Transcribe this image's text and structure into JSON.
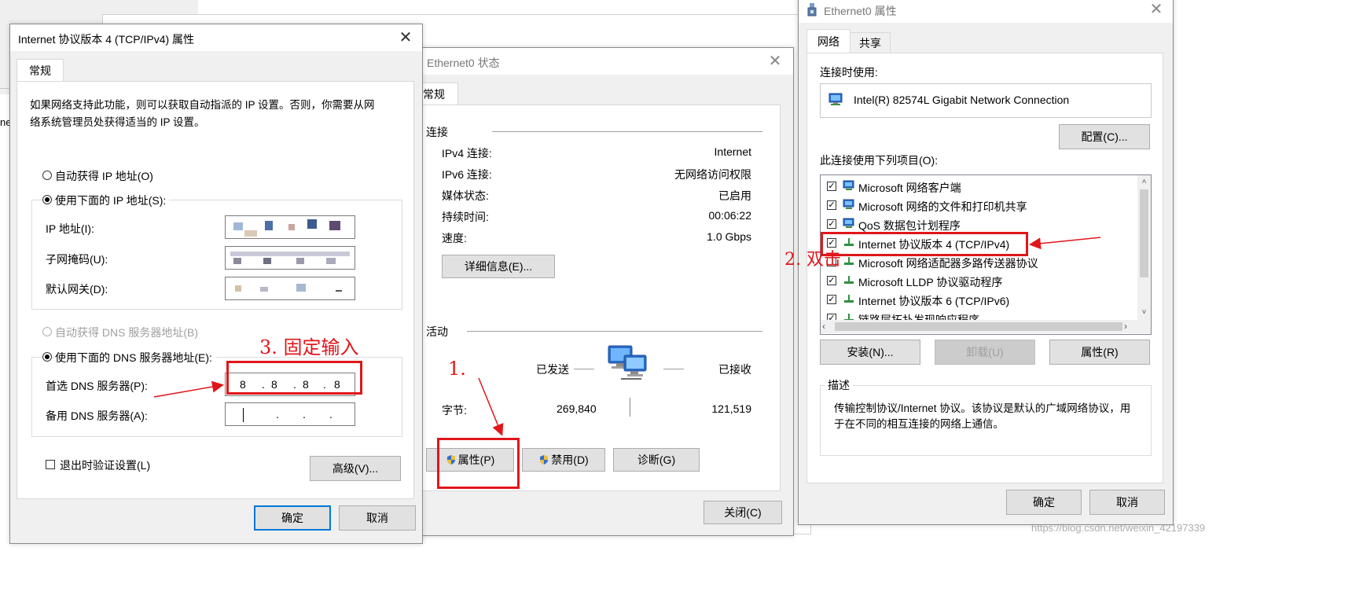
{
  "bg_window": {
    "left_fragment_text": "ne"
  },
  "ipv4_dialog": {
    "title": "Internet 协议版本 4 (TCP/IPv4) 属性",
    "tab_general": "常规",
    "description": "如果网络支持此功能，则可以获取自动指派的 IP 设置。否则，你需要从网络系统管理员处获得适当的 IP 设置。",
    "description_line1": "如果网络支持此功能，则可以获取自动指派的 IP 设置。否则，你需要从网",
    "description_line2": "络系统管理员处获得适当的 IP 设置。",
    "radio_auto_ip": "自动获得 IP 地址(O)",
    "radio_manual_ip": "使用下面的 IP 地址(S):",
    "ip_label": "IP 地址(I):",
    "mask_label": "子网掩码(U):",
    "gateway_label": "默认网关(D):",
    "radio_auto_dns": "自动获得 DNS 服务器地址(B)",
    "radio_manual_dns": "使用下面的 DNS 服务器地址(E):",
    "preferred_dns_label": "首选 DNS 服务器(P):",
    "preferred_dns_octets": [
      "8",
      "8",
      "8",
      "8"
    ],
    "alternate_dns_label": "备用 DNS 服务器(A):",
    "validate_label": "退出时验证设置(L)",
    "advanced_button": "高级(V)...",
    "ok_button": "确定",
    "cancel_button": "取消"
  },
  "status_dialog": {
    "title": "Ethernet0 状态",
    "tab_general": "常规",
    "connection_header": "连接",
    "rows": [
      {
        "label": "IPv4 连接:",
        "value": "Internet"
      },
      {
        "label": "IPv6 连接:",
        "value": "无网络访问权限"
      },
      {
        "label": "媒体状态:",
        "value": "已启用"
      },
      {
        "label": "持续时间:",
        "value": "00:06:22"
      },
      {
        "label": "速度:",
        "value": "1.0 Gbps"
      }
    ],
    "details_button": "详细信息(E)...",
    "activity_header": "活动",
    "sent_label": "已发送",
    "received_label": "已接收",
    "bytes_label": "字节:",
    "bytes_sent": "269,840",
    "bytes_received": "121,519",
    "properties_button": "属性(P)",
    "disable_button": "禁用(D)",
    "diagnose_button": "诊断(G)",
    "close_button": "关闭(C)"
  },
  "props_dialog": {
    "title": "Ethernet0 属性",
    "tab_network": "网络",
    "tab_sharing": "共享",
    "connect_using_label": "连接时使用:",
    "adapter_name": "Intel(R) 82574L Gigabit Network Connection",
    "configure_button": "配置(C)...",
    "items_label": "此连接使用下列项目(O):",
    "items": [
      {
        "label": "Microsoft 网络客户端",
        "checked": true,
        "icon": "network-client-icon"
      },
      {
        "label": "Microsoft 网络的文件和打印机共享",
        "checked": true,
        "icon": "network-client-icon"
      },
      {
        "label": "QoS 数据包计划程序",
        "checked": true,
        "icon": "network-client-icon"
      },
      {
        "label": "Internet 协议版本 4 (TCP/IPv4)",
        "checked": true,
        "icon": "protocol-icon"
      },
      {
        "label": "Microsoft 网络适配器多路传送器协议",
        "checked": false,
        "icon": "protocol-icon"
      },
      {
        "label": "Microsoft LLDP 协议驱动程序",
        "checked": true,
        "icon": "protocol-icon"
      },
      {
        "label": "Internet 协议版本 6 (TCP/IPv6)",
        "checked": true,
        "icon": "protocol-icon"
      },
      {
        "label": "链路层拓扑发现响应程序",
        "checked": true,
        "icon": "protocol-icon"
      }
    ],
    "install_button": "安装(N)...",
    "uninstall_button": "卸载(U)",
    "properties_button": "属性(R)",
    "description_header": "描述",
    "description_line1": "传输控制协议/Internet 协议。该协议是默认的广域网络协议，用",
    "description_line2": "于在不同的相互连接的网络上通信。",
    "ok_button": "确定",
    "cancel_button": "取消"
  },
  "annotations": {
    "step1": "1.",
    "step2": "2. 双击",
    "step3": "3. 固定输入",
    "color": "#e0161b"
  },
  "watermark": "https://blog.csdn.net/weixin_42197339"
}
